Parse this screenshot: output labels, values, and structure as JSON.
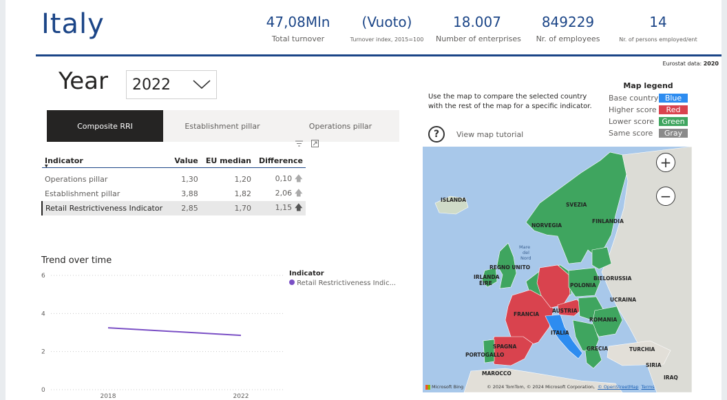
{
  "country": "Italy",
  "kpis": [
    {
      "value": "47,08Mln",
      "label": "Total turnover"
    },
    {
      "value": "(Vuoto)",
      "label": "Turnover index, 2015=100"
    },
    {
      "value": "18.007",
      "label": "Number of enterprises"
    },
    {
      "value": "849229",
      "label": "Nr. of employees"
    },
    {
      "value": "14",
      "label": "Nr. of persons employed/ent"
    }
  ],
  "eurostat": {
    "label": "Eurostat data:",
    "year": "2020"
  },
  "year_filter": {
    "label": "Year",
    "selected": "2022"
  },
  "tabs": [
    "Composite RRI",
    "Establishment pillar",
    "Operations pillar"
  ],
  "active_tab": 0,
  "table": {
    "columns": [
      "Indicator",
      "Value",
      "EU median",
      "Difference"
    ],
    "rows": [
      {
        "indicator": "Operations pillar",
        "value": "1,30",
        "eu_median": "1,20",
        "difference": "0,10"
      },
      {
        "indicator": "Establishment pillar",
        "value": "3,88",
        "eu_median": "1,82",
        "difference": "2,06"
      },
      {
        "indicator": "Retail Restrictiveness Indicator",
        "value": "2,85",
        "eu_median": "1,70",
        "difference": "1,15"
      }
    ]
  },
  "trend": {
    "title": "Trend over time",
    "legend_title": "Indicator",
    "series_label": "Retail Restrictiveness Indic..."
  },
  "chart_data": {
    "type": "line",
    "x": [
      "2018",
      "2022"
    ],
    "series": [
      {
        "name": "Retail Restrictiveness Indic...",
        "values": [
          3.25,
          2.85
        ]
      }
    ],
    "ylim": [
      0,
      6
    ],
    "yticks": [
      "0",
      "2",
      "4",
      "6"
    ],
    "grid": true,
    "legend_placement": "right",
    "colors": {
      "line": "#7a4fc5"
    }
  },
  "map_info": {
    "instructions_line1": "Use the map to compare the selected country",
    "instructions_line2": "with the rest of the map for a specific indicator.",
    "tutorial": "View map tutorial",
    "legend_title": "Map legend",
    "legend": [
      {
        "label": "Base country",
        "swatch": "Blue",
        "color": "#2d8cf0"
      },
      {
        "label": "Higher score",
        "swatch": "Red",
        "color": "#d9434e"
      },
      {
        "label": "Lower score",
        "swatch": "Green",
        "color": "#3fa55f"
      },
      {
        "label": "Same score",
        "swatch": "Gray",
        "color": "#8a8a8a"
      }
    ]
  },
  "map_labels": {
    "islanda": "ISLANDA",
    "svezia": "SVEZIA",
    "finlandia": "FINLANDIA",
    "norvegia": "NORVEGIA",
    "mare1": "Mare",
    "mare2": "del",
    "mare3": "Nord",
    "regno_unito": "REGNO UNITO",
    "irlanda": "IRLANDA",
    "eire": "ÉIRE",
    "bielorussia": "BIELORUSSIA",
    "polonia": "POLONIA",
    "ucraina": "UCRAINA",
    "austria": "AUSTRIA",
    "francia": "FRANCIA",
    "romania": "ROMANIA",
    "italia": "ITALIA",
    "spagna": "SPAGNA",
    "portogallo": "PORTOGALLO",
    "grecia": "GRECIA",
    "turchia": "TURCHIA",
    "siria": "SIRIA",
    "marocco": "MAROCCO",
    "iraq": "IRAQ"
  },
  "map_attribution": {
    "brand": "Microsoft Bing",
    "text": "© 2024 TomTom, © 2024 Microsoft Corporation,",
    "osm": "© OpenStreetMap",
    "terms": "Terms"
  },
  "icons": {
    "zoom_in": "+",
    "zoom_out": "−",
    "help": "?"
  }
}
